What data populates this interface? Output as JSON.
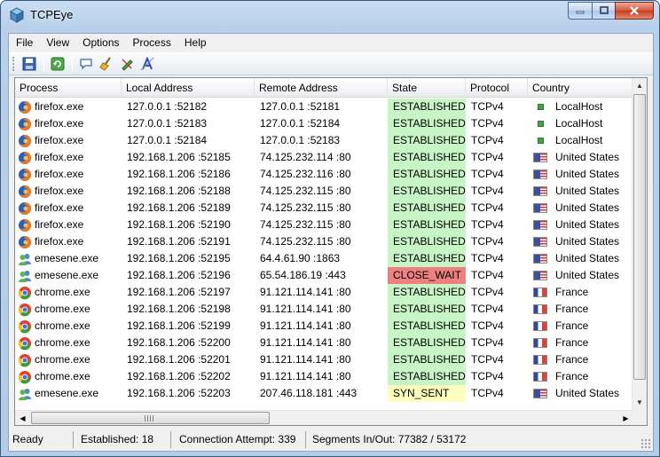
{
  "window": {
    "title": "TCPEye"
  },
  "menu": [
    "File",
    "View",
    "Options",
    "Process",
    "Help"
  ],
  "toolbar": [
    {
      "icon": "save-icon"
    },
    {
      "icon": "refresh-icon"
    },
    {
      "icon": "chat-balloon-icon"
    },
    {
      "icon": "broom-icon"
    },
    {
      "icon": "pen-icon"
    },
    {
      "icon": "text-effect-icon"
    }
  ],
  "columns": [
    "Process",
    "Local Address",
    "Remote Address",
    "State",
    "Protocol",
    "Country"
  ],
  "rows": [
    {
      "process": "firefox.exe",
      "pkind": "firefox",
      "local": "127.0.0.1 :52182",
      "remote": "127.0.0.1 :52181",
      "state": "ESTABLISHED",
      "skind": "est",
      "protocol": "TCPv4",
      "country": "LocalHost",
      "flag": "lh"
    },
    {
      "process": "firefox.exe",
      "pkind": "firefox",
      "local": "127.0.0.1 :52183",
      "remote": "127.0.0.1 :52184",
      "state": "ESTABLISHED",
      "skind": "est",
      "protocol": "TCPv4",
      "country": "LocalHost",
      "flag": "lh"
    },
    {
      "process": "firefox.exe",
      "pkind": "firefox",
      "local": "127.0.0.1 :52184",
      "remote": "127.0.0.1 :52183",
      "state": "ESTABLISHED",
      "skind": "est",
      "protocol": "TCPv4",
      "country": "LocalHost",
      "flag": "lh"
    },
    {
      "process": "firefox.exe",
      "pkind": "firefox",
      "local": "192.168.1.206 :52185",
      "remote": "74.125.232.114 :80",
      "state": "ESTABLISHED",
      "skind": "est",
      "protocol": "TCPv4",
      "country": "United States",
      "flag": "us"
    },
    {
      "process": "firefox.exe",
      "pkind": "firefox",
      "local": "192.168.1.206 :52186",
      "remote": "74.125.232.116 :80",
      "state": "ESTABLISHED",
      "skind": "est",
      "protocol": "TCPv4",
      "country": "United States",
      "flag": "us"
    },
    {
      "process": "firefox.exe",
      "pkind": "firefox",
      "local": "192.168.1.206 :52188",
      "remote": "74.125.232.115 :80",
      "state": "ESTABLISHED",
      "skind": "est",
      "protocol": "TCPv4",
      "country": "United States",
      "flag": "us"
    },
    {
      "process": "firefox.exe",
      "pkind": "firefox",
      "local": "192.168.1.206 :52189",
      "remote": "74.125.232.115 :80",
      "state": "ESTABLISHED",
      "skind": "est",
      "protocol": "TCPv4",
      "country": "United States",
      "flag": "us"
    },
    {
      "process": "firefox.exe",
      "pkind": "firefox",
      "local": "192.168.1.206 :52190",
      "remote": "74.125.232.115 :80",
      "state": "ESTABLISHED",
      "skind": "est",
      "protocol": "TCPv4",
      "country": "United States",
      "flag": "us"
    },
    {
      "process": "firefox.exe",
      "pkind": "firefox",
      "local": "192.168.1.206 :52191",
      "remote": "74.125.232.115 :80",
      "state": "ESTABLISHED",
      "skind": "est",
      "protocol": "TCPv4",
      "country": "United States",
      "flag": "us"
    },
    {
      "process": "emesene.exe",
      "pkind": "emesene",
      "local": "192.168.1.206 :52195",
      "remote": "64.4.61.90 :1863",
      "state": "ESTABLISHED",
      "skind": "est",
      "protocol": "TCPv4",
      "country": "United States",
      "flag": "us"
    },
    {
      "process": "emesene.exe",
      "pkind": "emesene",
      "local": "192.168.1.206 :52196",
      "remote": "65.54.186.19 :443",
      "state": "CLOSE_WAIT",
      "skind": "close",
      "protocol": "TCPv4",
      "country": "United States",
      "flag": "us"
    },
    {
      "process": "chrome.exe",
      "pkind": "chrome",
      "local": "192.168.1.206 :52197",
      "remote": "91.121.114.141 :80",
      "state": "ESTABLISHED",
      "skind": "est",
      "protocol": "TCPv4",
      "country": "France",
      "flag": "fr"
    },
    {
      "process": "chrome.exe",
      "pkind": "chrome",
      "local": "192.168.1.206 :52198",
      "remote": "91.121.114.141 :80",
      "state": "ESTABLISHED",
      "skind": "est",
      "protocol": "TCPv4",
      "country": "France",
      "flag": "fr"
    },
    {
      "process": "chrome.exe",
      "pkind": "chrome",
      "local": "192.168.1.206 :52199",
      "remote": "91.121.114.141 :80",
      "state": "ESTABLISHED",
      "skind": "est",
      "protocol": "TCPv4",
      "country": "France",
      "flag": "fr"
    },
    {
      "process": "chrome.exe",
      "pkind": "chrome",
      "local": "192.168.1.206 :52200",
      "remote": "91.121.114.141 :80",
      "state": "ESTABLISHED",
      "skind": "est",
      "protocol": "TCPv4",
      "country": "France",
      "flag": "fr"
    },
    {
      "process": "chrome.exe",
      "pkind": "chrome",
      "local": "192.168.1.206 :52201",
      "remote": "91.121.114.141 :80",
      "state": "ESTABLISHED",
      "skind": "est",
      "protocol": "TCPv4",
      "country": "France",
      "flag": "fr"
    },
    {
      "process": "chrome.exe",
      "pkind": "chrome",
      "local": "192.168.1.206 :52202",
      "remote": "91.121.114.141 :80",
      "state": "ESTABLISHED",
      "skind": "est",
      "protocol": "TCPv4",
      "country": "France",
      "flag": "fr"
    },
    {
      "process": "emesene.exe",
      "pkind": "emesene",
      "local": "192.168.1.206 :52203",
      "remote": "207.46.118.181 :443",
      "state": "SYN_SENT",
      "skind": "syn",
      "protocol": "TCPv4",
      "country": "United States",
      "flag": "us"
    }
  ],
  "state_colors": {
    "est": "#c8f5c6",
    "close": "#f08080",
    "syn": "#fdfdbd"
  },
  "status": {
    "ready": "Ready",
    "established": "Established: 18",
    "attempt": "Connection Attempt: 339",
    "segments": "Segments In/Out: 77382 / 53172"
  }
}
